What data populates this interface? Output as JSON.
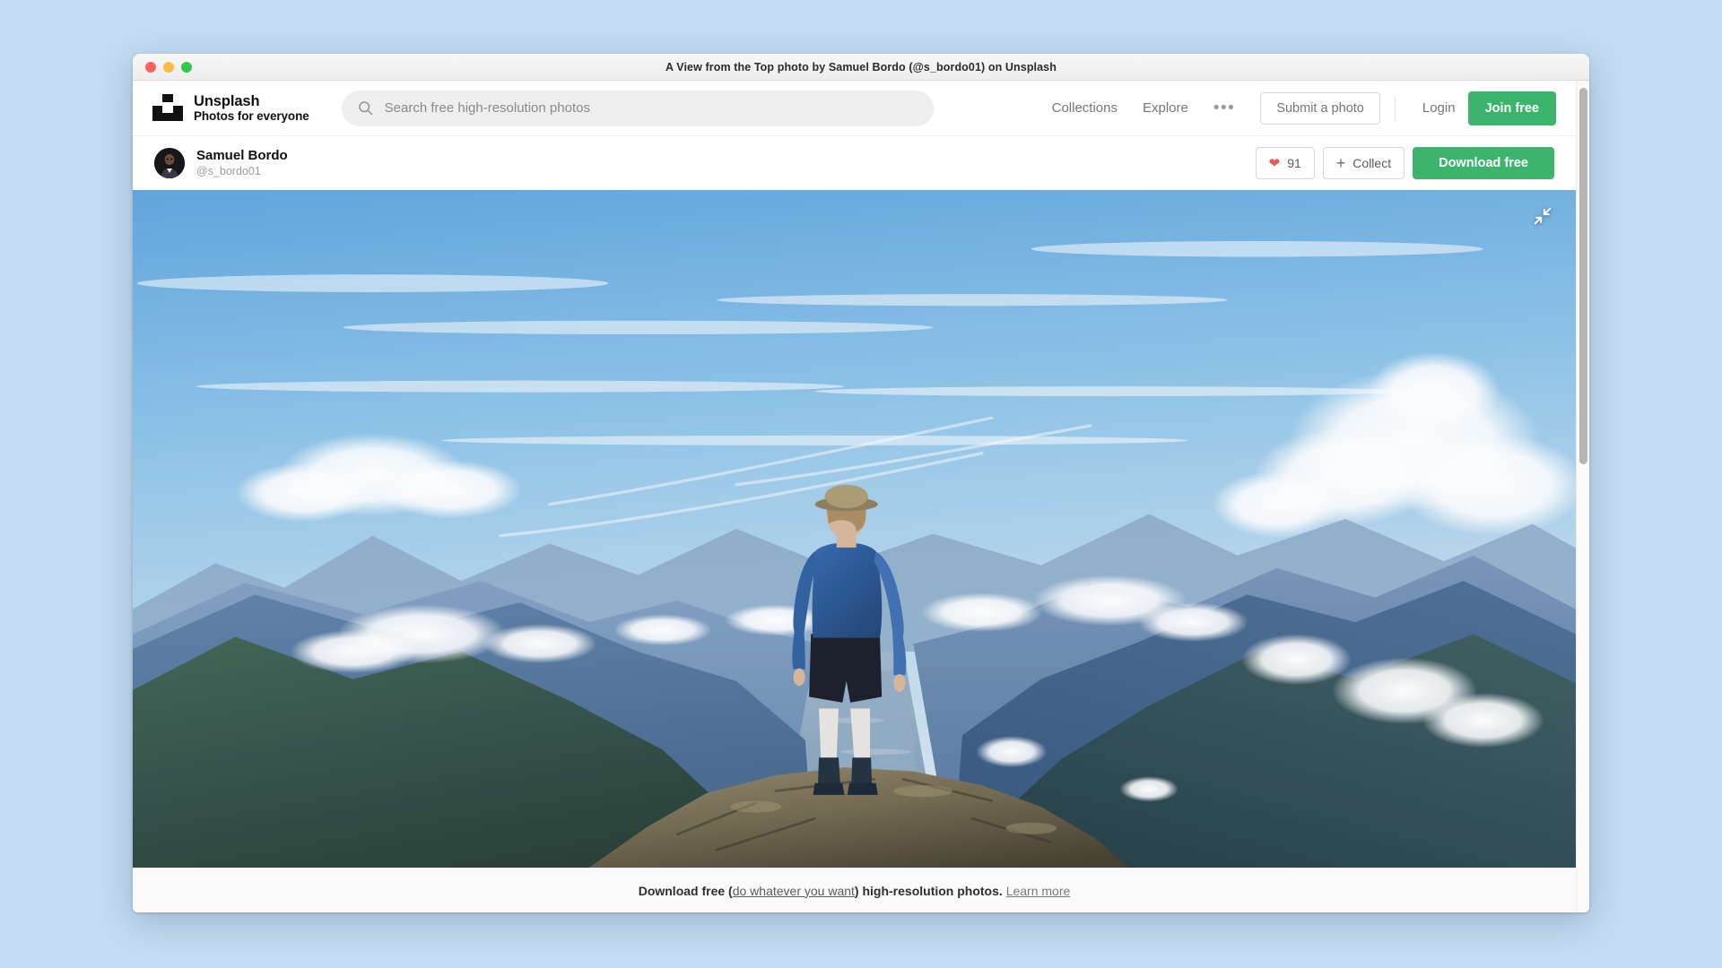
{
  "window": {
    "title": "A View from the Top photo by Samuel Bordo (@s_bordo01) on Unsplash",
    "traffic_lights": [
      "close",
      "minimize",
      "maximize"
    ]
  },
  "header": {
    "brand_name": "Unsplash",
    "brand_tagline": "Photos for everyone",
    "logo_icon": "unsplash-camera-icon",
    "search": {
      "icon": "search-icon",
      "placeholder": "Search free high-resolution photos",
      "value": ""
    },
    "nav_links": [
      {
        "label": "Collections"
      },
      {
        "label": "Explore"
      }
    ],
    "more_icon": "ellipsis-icon",
    "submit_label": "Submit a photo",
    "login_label": "Login",
    "join_label": "Join free"
  },
  "author_bar": {
    "avatar_icon": "user-avatar",
    "name": "Samuel Bordo",
    "handle": "@s_bordo01",
    "like": {
      "icon": "heart-icon",
      "count": "91"
    },
    "collect": {
      "icon": "plus-icon",
      "label": "Collect"
    },
    "download_label": "Download free"
  },
  "photo": {
    "alt_title": "A View from the Top",
    "collapse_icon": "collapse-arrows-icon",
    "description": "Hiker in blue long-sleeve shirt and black shorts standing on a rocky summit overlooking a fjord between forested mountain ranges under a blue sky with clouds"
  },
  "footer": {
    "text_before": "Download free (",
    "link_1": "do whatever you want",
    "text_middle": ") high-resolution photos. ",
    "link_2": "Learn more"
  },
  "colors": {
    "accent_green": "#3cb46e",
    "heart_red": "#eb5757",
    "desktop_bg": "#c5ddf2",
    "search_bg": "#eeeeee"
  }
}
